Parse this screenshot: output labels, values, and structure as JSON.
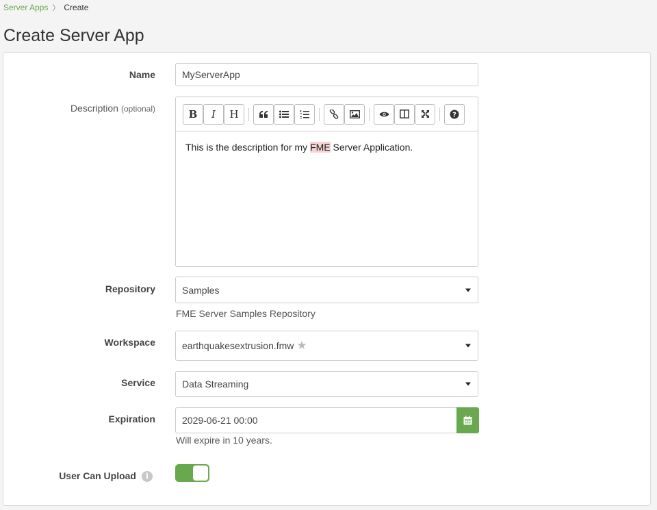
{
  "breadcrumb": {
    "link": "Server Apps",
    "current": "Create"
  },
  "title": "Create Server App",
  "form": {
    "name": {
      "label": "Name",
      "value": "MyServerApp"
    },
    "description": {
      "label": "Description",
      "optional": "(optional)",
      "text_before": "This is the description for my ",
      "text_highlight": "FME",
      "text_after": " Server Application."
    },
    "repository": {
      "label": "Repository",
      "value": "Samples",
      "help": "FME Server Samples Repository"
    },
    "workspace": {
      "label": "Workspace",
      "value": "earthquakesextrusion.fmw"
    },
    "service": {
      "label": "Service",
      "value": "Data Streaming"
    },
    "expiration": {
      "label": "Expiration",
      "value": "2029-06-21 00:00",
      "help": "Will expire in 10 years."
    },
    "upload": {
      "label": "User Can Upload",
      "enabled": true
    }
  },
  "toolbar": {
    "bold": "B",
    "italic": "I",
    "heading": "H"
  },
  "colors": {
    "accent": "#6aa84f",
    "highlight": "#f8d4d6"
  }
}
